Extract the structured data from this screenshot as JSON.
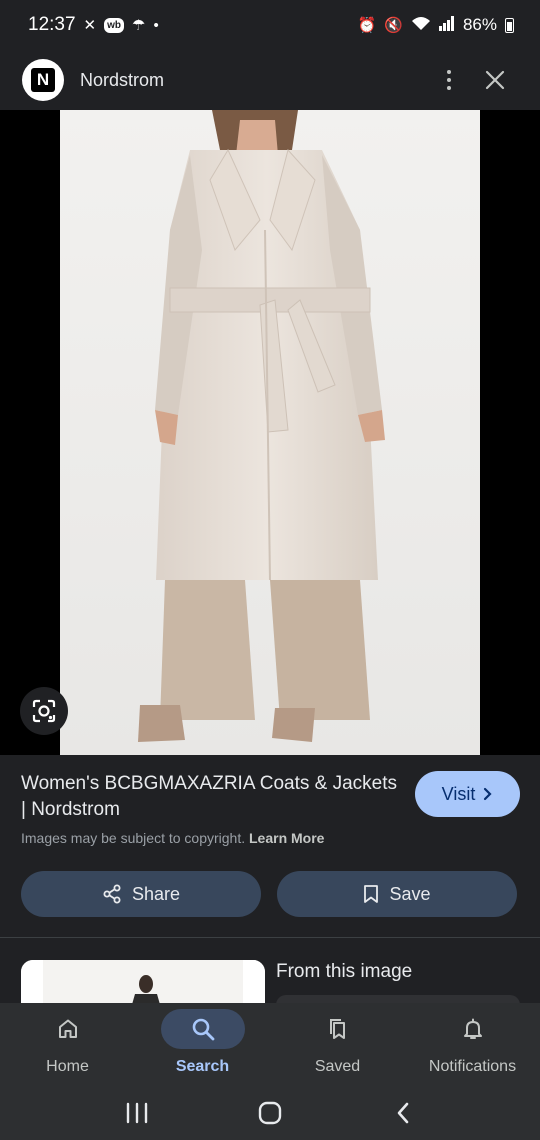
{
  "status_bar": {
    "time": "12:37",
    "wb_badge": "wb",
    "battery": "86%"
  },
  "header": {
    "logo_letter": "N",
    "site_name": "Nordstrom",
    "more_icon": "more-vert-icon",
    "close_icon": "close-icon"
  },
  "result": {
    "title": "Women's BCBGMAXAZRIA Coats & Jackets | Nordstrom",
    "visit_label": "Visit",
    "copyright_text": "Images may be subject to copyright.",
    "learn_more": "Learn More",
    "share_label": "Share",
    "save_label": "Save",
    "section_title": "From this image"
  },
  "bottom_nav": {
    "items": [
      {
        "label": "Home",
        "icon": "home-icon"
      },
      {
        "label": "Search",
        "icon": "search-icon",
        "active": true
      },
      {
        "label": "Saved",
        "icon": "saved-icon"
      },
      {
        "label": "Notifications",
        "icon": "bell-icon"
      }
    ]
  },
  "colors": {
    "background": "#202124",
    "accent": "#a8c7fa",
    "pill_bg": "#38475c",
    "nav_bg": "#2d2f31"
  }
}
